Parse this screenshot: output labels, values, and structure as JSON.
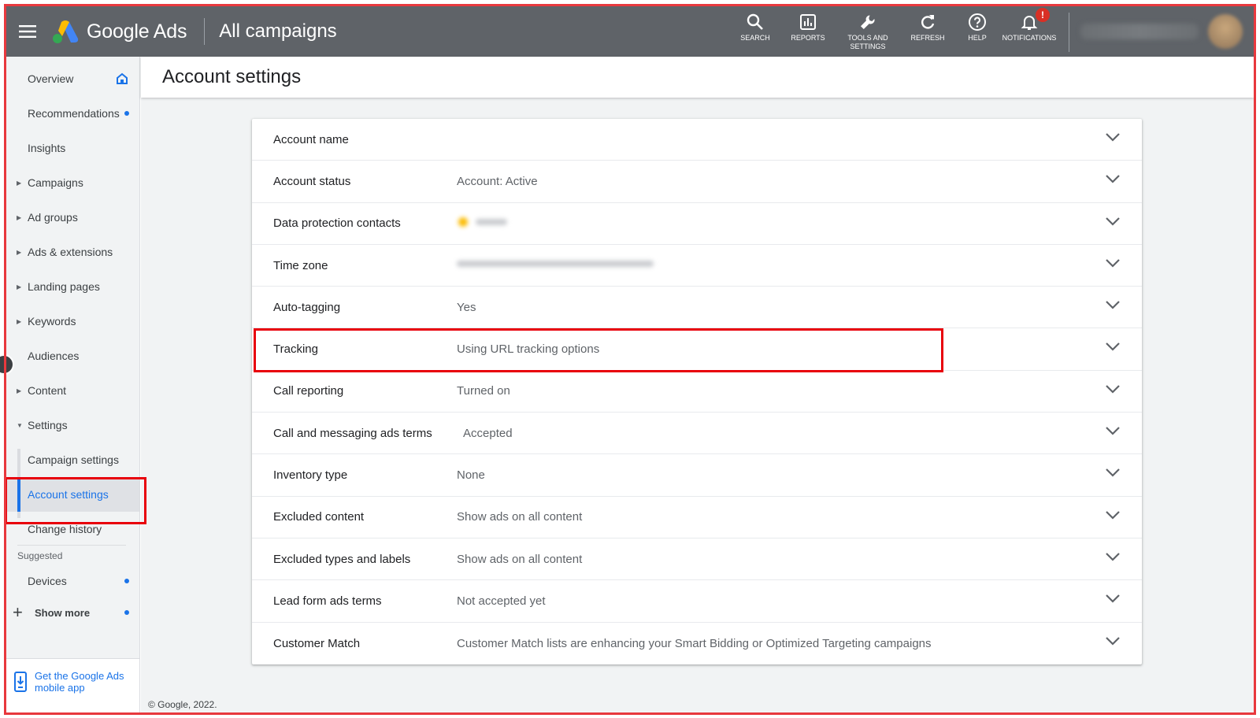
{
  "colors": {
    "accent": "#1a73e8",
    "topbar": "#5f6368",
    "highlight": "#e8000b",
    "notification_badge": "#d93025"
  },
  "topbar": {
    "logo_text": "Google Ads",
    "page_heading": "All campaigns",
    "tools": [
      {
        "label": "SEARCH",
        "icon": "search-icon"
      },
      {
        "label": "REPORTS",
        "icon": "reports-icon"
      },
      {
        "label": "TOOLS AND SETTINGS",
        "icon": "wrench-icon"
      },
      {
        "label": "REFRESH",
        "icon": "refresh-icon"
      },
      {
        "label": "HELP",
        "icon": "help-icon"
      },
      {
        "label": "NOTIFICATIONS",
        "icon": "bell-icon",
        "badge": "!"
      }
    ]
  },
  "sidebar": {
    "items": [
      {
        "label": "Overview",
        "icon": "home-icon"
      },
      {
        "label": "Recommendations",
        "dot": true
      },
      {
        "label": "Insights"
      },
      {
        "label": "Campaigns",
        "expandable": true
      },
      {
        "label": "Ad groups",
        "expandable": true
      },
      {
        "label": "Ads & extensions",
        "expandable": true
      },
      {
        "label": "Landing pages",
        "expandable": true
      },
      {
        "label": "Keywords",
        "expandable": true
      },
      {
        "label": "Audiences"
      },
      {
        "label": "Content",
        "expandable": true
      },
      {
        "label": "Settings",
        "expanded": true
      },
      {
        "label": "Campaign settings"
      },
      {
        "label": "Account settings",
        "active": true
      },
      {
        "label": "Change history"
      }
    ],
    "suggested_label": "Suggested",
    "suggested_items": [
      {
        "label": "Devices",
        "dot": true
      }
    ],
    "show_more": "Show more",
    "mobile_app": "Get the Google Ads mobile app"
  },
  "main": {
    "title": "Account settings",
    "rows": [
      {
        "label": "Account name",
        "value": ""
      },
      {
        "label": "Account status",
        "value": "Account: Active"
      },
      {
        "label": "Data protection contacts",
        "value": "",
        "blurred": true
      },
      {
        "label": "Time zone",
        "value": "",
        "blurred": true
      },
      {
        "label": "Auto-tagging",
        "value": "Yes"
      },
      {
        "label": "Tracking",
        "value": "Using URL tracking options"
      },
      {
        "label": "Call reporting",
        "value": "Turned on"
      },
      {
        "label": "Call and messaging ads terms",
        "value": "Accepted"
      },
      {
        "label": "Inventory type",
        "value": "None"
      },
      {
        "label": "Excluded content",
        "value": "Show ads on all content"
      },
      {
        "label": "Excluded types and labels",
        "value": "Show ads on all content"
      },
      {
        "label": "Lead form ads terms",
        "value": "Not accepted yet"
      },
      {
        "label": "Customer Match",
        "value": "Customer Match lists are enhancing your Smart Bidding or Optimized Targeting campaigns"
      }
    ],
    "copyright": "© Google, 2022."
  }
}
